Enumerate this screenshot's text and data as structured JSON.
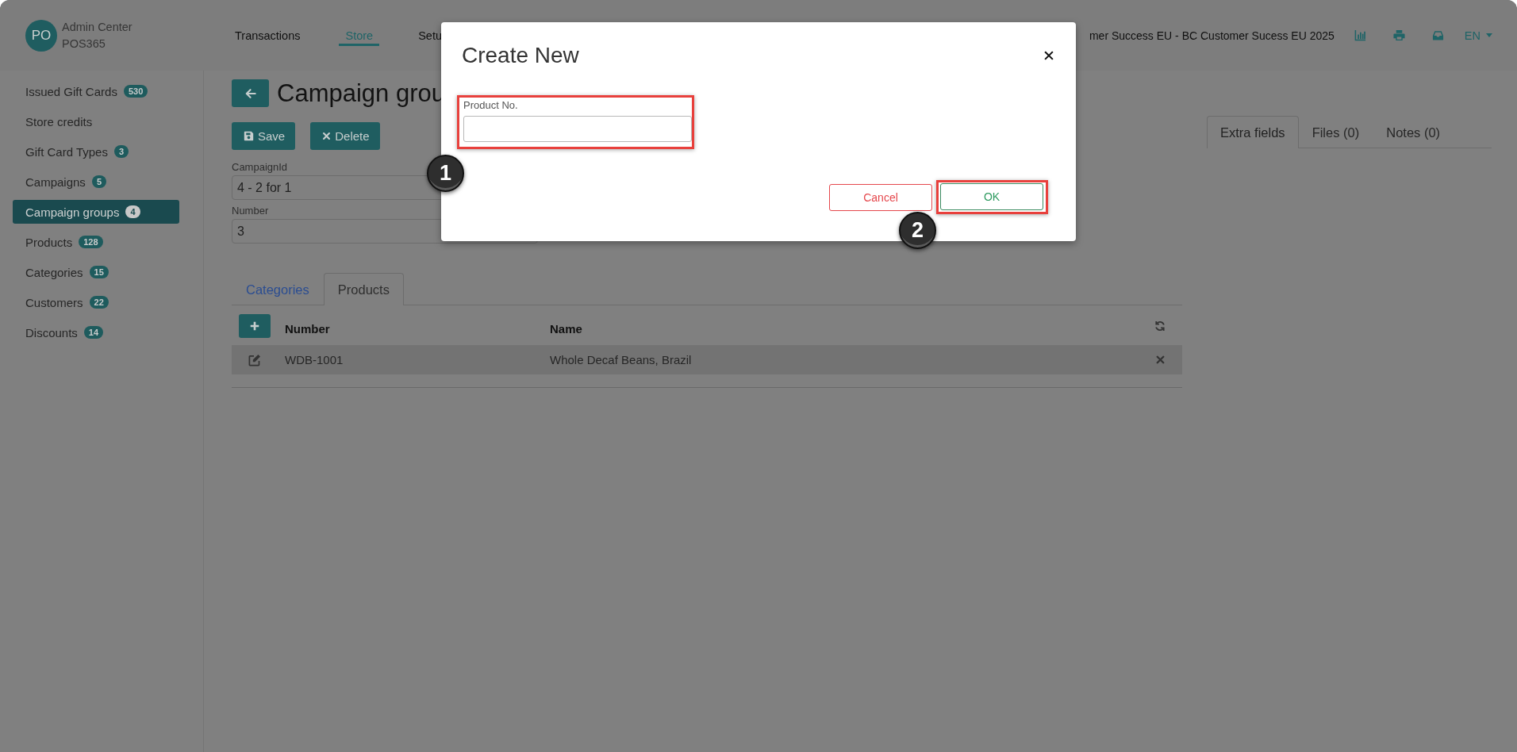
{
  "header": {
    "avatar": "PO",
    "app_title": "Admin Center",
    "app_subtitle": "POS365",
    "nav": [
      {
        "label": "Transactions",
        "selected": false
      },
      {
        "label": "Store",
        "selected": true
      },
      {
        "label": "Setu",
        "selected": false
      }
    ],
    "organization": "mer Success EU - BC Customer Sucess EU 2025",
    "language": "EN"
  },
  "sidebar": {
    "items": [
      {
        "label": "Issued Gift Cards",
        "count": "530",
        "selected": false
      },
      {
        "label": "Store credits",
        "selected": false
      },
      {
        "label": "Gift Card Types",
        "count": "3",
        "selected": false
      },
      {
        "label": "Campaigns",
        "count": "5",
        "selected": false
      },
      {
        "label": "Campaign groups",
        "count": "4",
        "selected": true
      },
      {
        "label": "Products",
        "count": "128",
        "selected": false
      },
      {
        "label": "Categories",
        "count": "15",
        "selected": false
      },
      {
        "label": "Customers",
        "count": "22",
        "selected": false
      },
      {
        "label": "Discounts",
        "count": "14",
        "selected": false
      }
    ]
  },
  "page": {
    "title": "Campaign grou",
    "actions": [
      {
        "kind": "save",
        "label": "Save"
      },
      {
        "kind": "delete",
        "label": "Delete"
      }
    ],
    "fields": [
      {
        "label": "CampaignId",
        "value": "4 - 2 for 1"
      },
      {
        "label": "Number",
        "value": "3"
      }
    ],
    "tabs": [
      {
        "label": "Categories",
        "selected": false
      },
      {
        "label": "Products",
        "selected": true
      }
    ],
    "table": {
      "columns": [
        "Number",
        "Name"
      ],
      "rows": [
        {
          "cells": [
            "WDB-1001",
            "Whole Decaf Beans, Brazil"
          ],
          "highlighted": true
        }
      ]
    }
  },
  "side_tabs": [
    {
      "label": "Extra fields",
      "selected": true
    },
    {
      "label": "Files (0)",
      "selected": false
    },
    {
      "label": "Notes (0)",
      "selected": false
    }
  ],
  "dialog": {
    "title": "Create New",
    "field": {
      "label": "Product No.",
      "highlighted": true,
      "callout": "1"
    },
    "buttons": [
      {
        "kind": "cancel",
        "label": "Cancel",
        "highlighted": false
      },
      {
        "kind": "ok",
        "label": "OK",
        "highlighted": true,
        "callout": "2"
      }
    ]
  }
}
